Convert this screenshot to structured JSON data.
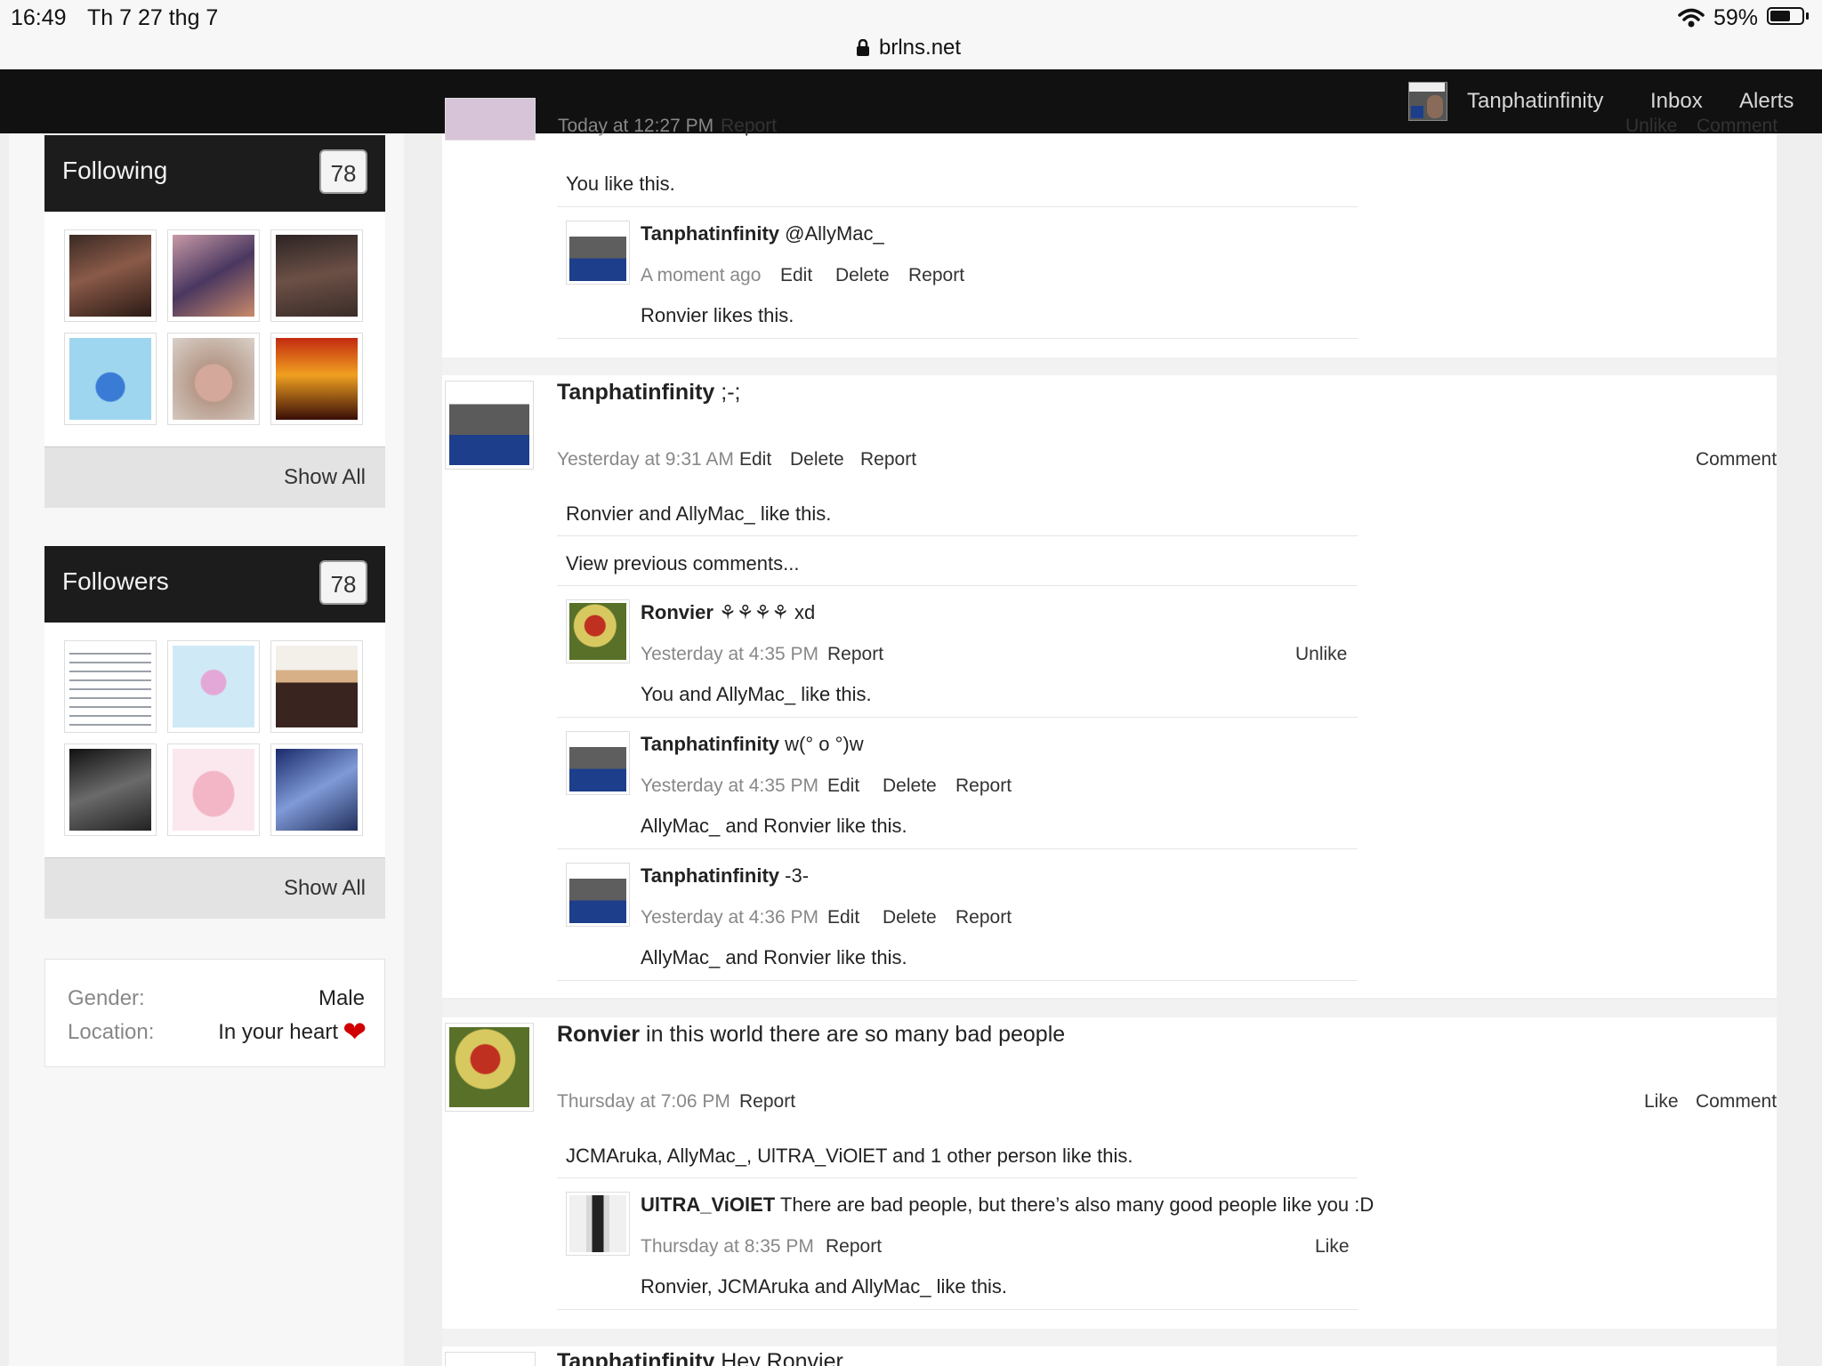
{
  "status_bar": {
    "time": "16:49",
    "date": "Th 7 27 thg 7",
    "battery": "59%",
    "url": "brlns.net"
  },
  "colors": {
    "nav_bg": "#111111",
    "heart": "#d10000"
  },
  "nav": {
    "username": "Tanphatinfinity",
    "inbox": "Inbox",
    "alerts": "Alerts"
  },
  "sidebar": {
    "following": {
      "title": "Following",
      "count": "78",
      "show_all": "Show All"
    },
    "followers": {
      "title": "Followers",
      "count": "78",
      "show_all": "Show All"
    },
    "info": {
      "gender_label": "Gender:",
      "gender_value": "Male",
      "location_label": "Location:",
      "location_value": "In your heart"
    }
  },
  "top_partial": {
    "post_meta": "Today at 12:27 PM",
    "post_report": "Report",
    "post_unlike": "Unlike",
    "post_comment": "Comment",
    "likes": "You like this.",
    "comment": {
      "author": "Tanphatinfinity",
      "text": "@AllyMac_",
      "time": "A moment ago",
      "edit": "Edit",
      "delete": "Delete",
      "report": "Report",
      "likes": "Ronvier likes this."
    }
  },
  "post2": {
    "author": "Tanphatinfinity",
    "text": ";-;",
    "time": "Yesterday at 9:31 AM",
    "edit": "Edit",
    "delete": "Delete",
    "report": "Report",
    "comment": "Comment",
    "likes": "Ronvier and AllyMac_ like this.",
    "view_previous": "View previous comments...",
    "c1": {
      "author": "Ronvier",
      "text": "⚘⚘⚘⚘ xd",
      "time": "Yesterday at 4:35 PM",
      "report": "Report",
      "unlike": "Unlike",
      "likes": "You and AllyMac_ like this."
    },
    "c2": {
      "author": "Tanphatinfinity",
      "text": "w(° o °)w",
      "time": "Yesterday at 4:35 PM",
      "edit": "Edit",
      "delete": "Delete",
      "report": "Report",
      "likes": "AllyMac_ and Ronvier like this."
    },
    "c3": {
      "author": "Tanphatinfinity",
      "text": "-3-",
      "time": "Yesterday at 4:36 PM",
      "edit": "Edit",
      "delete": "Delete",
      "report": "Report",
      "likes": "AllyMac_ and Ronvier like this."
    }
  },
  "post3": {
    "author": "Ronvier",
    "text": "in this world there are so many bad people",
    "time": "Thursday at 7:06 PM",
    "report": "Report",
    "like": "Like",
    "comment": "Comment",
    "likes": "JCMAruka, AllyMac_, UlTRA_ViOlET and 1 other person like this.",
    "c1": {
      "author": "UlTRA_ViOlET",
      "text": "There are bad people, but there’s also many good people like you :D",
      "time": "Thursday at 8:35 PM",
      "report": "Report",
      "like": "Like",
      "likes": "Ronvier, JCMAruka and AllyMac_ like this."
    }
  },
  "post4": {
    "author": "Tanphatinfinity",
    "text": "Hey Ronvier"
  }
}
